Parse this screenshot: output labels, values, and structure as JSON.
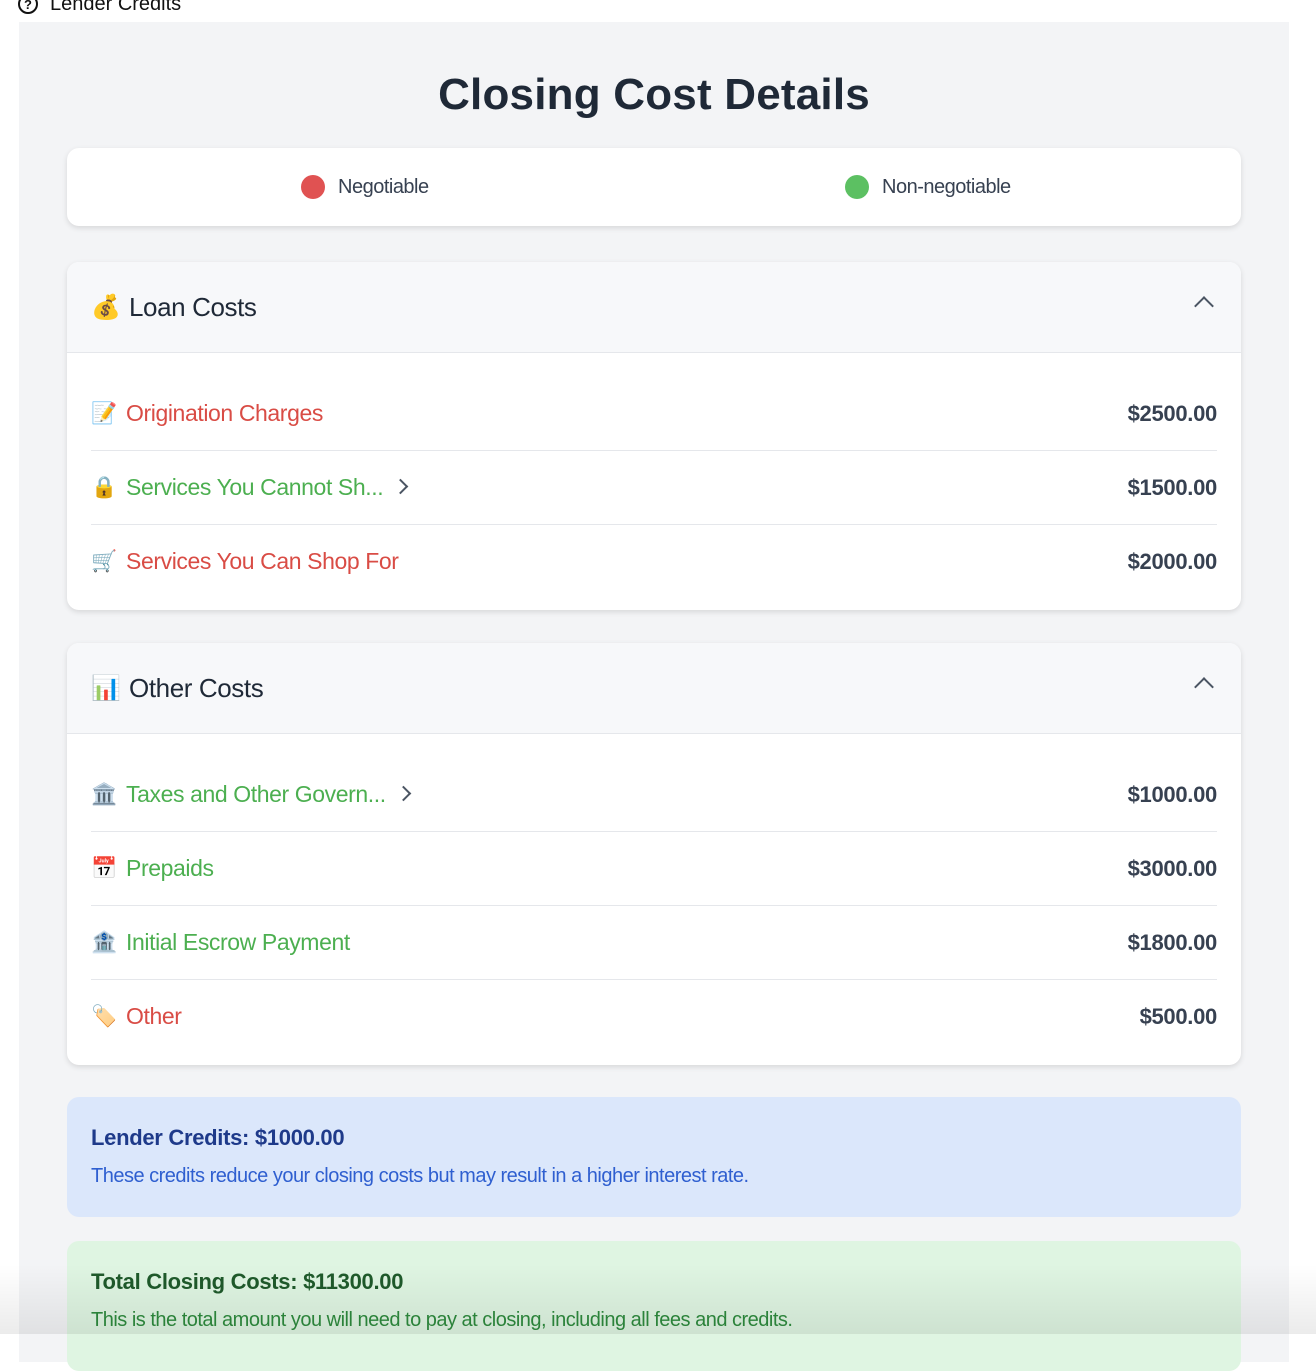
{
  "topbar": {
    "label": "Lender Credits",
    "icon": "question-circle-icon"
  },
  "page_title": "Closing Cost Details",
  "legend": [
    {
      "label": "Negotiable",
      "color": "#e05252"
    },
    {
      "label": "Non-negotiable",
      "color": "#5cc062"
    }
  ],
  "sections": [
    {
      "emoji": "💰",
      "title": "Loan Costs",
      "items": [
        {
          "emoji": "📝",
          "label": "Origination Charges",
          "amount": "$2500.00",
          "negotiable": true,
          "expandable": false
        },
        {
          "emoji": "🔒",
          "label": "Services You Cannot Sh...",
          "amount": "$1500.00",
          "negotiable": false,
          "expandable": true
        },
        {
          "emoji": "🛒",
          "label": "Services You Can Shop For",
          "amount": "$2000.00",
          "negotiable": true,
          "expandable": false
        }
      ]
    },
    {
      "emoji": "📊",
      "title": "Other Costs",
      "items": [
        {
          "emoji": "🏛️",
          "label": "Taxes and Other Govern...",
          "amount": "$1000.00",
          "negotiable": false,
          "expandable": true
        },
        {
          "emoji": "📅",
          "label": "Prepaids",
          "amount": "$3000.00",
          "negotiable": false,
          "expandable": false
        },
        {
          "emoji": "🏦",
          "label": "Initial Escrow Payment",
          "amount": "$1800.00",
          "negotiable": false,
          "expandable": false
        },
        {
          "emoji": "🏷️",
          "label": "Other",
          "amount": "$500.00",
          "negotiable": true,
          "expandable": false
        }
      ]
    }
  ],
  "lender_credits": {
    "title": "Lender Credits: $1000.00",
    "text": "These credits reduce your closing costs but may result in a higher interest rate."
  },
  "total": {
    "title": "Total Closing Costs: $11300.00",
    "text": "This is the total amount you will need to pay at closing, including all fees and credits."
  },
  "colors": {
    "negotiable_text": "#d94c45",
    "non_negotiable_text": "#4caf50",
    "lender_bg": "#dbe7fb",
    "lender_title": "#1e3a8a",
    "lender_text": "#2f5fd0",
    "total_bg": "#dff5e2",
    "total_title": "#1f5a2b",
    "total_text": "#2e8b3e"
  }
}
